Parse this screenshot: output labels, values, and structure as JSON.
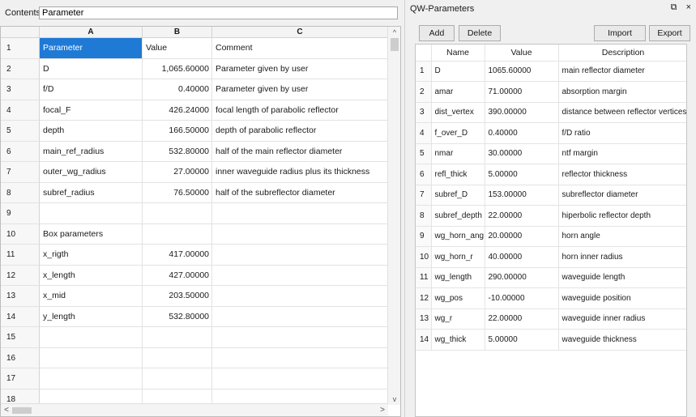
{
  "sheet": {
    "contents_label": "Contents",
    "contents_value": "Parameter",
    "columns": [
      "A",
      "B",
      "C"
    ],
    "rows": [
      {
        "n": "1",
        "a": "Parameter",
        "b": "Value",
        "c": "Comment",
        "selected_a": true
      },
      {
        "n": "2",
        "a": "D",
        "b": "1,065.60000",
        "c": "Parameter given by user"
      },
      {
        "n": "3",
        "a": "f/D",
        "b": "0.40000",
        "c": "Parameter given by user"
      },
      {
        "n": "4",
        "a": "focal_F",
        "b": "426.24000",
        "c": "focal length of parabolic reflector"
      },
      {
        "n": "5",
        "a": "depth",
        "b": "166.50000",
        "c": "depth of parabolic reflector"
      },
      {
        "n": "6",
        "a": "main_ref_radius",
        "b": "532.80000",
        "c": "half of the main reflector diameter"
      },
      {
        "n": "7",
        "a": "outer_wg_radius",
        "b": "27.00000",
        "c": "inner waveguide radius plus its thickness"
      },
      {
        "n": "8",
        "a": "subref_radius",
        "b": "76.50000",
        "c": "half of the subreflector diameter"
      },
      {
        "n": "9",
        "a": "",
        "b": "",
        "c": ""
      },
      {
        "n": "10",
        "a": "Box parameters",
        "b": "",
        "c": ""
      },
      {
        "n": "11",
        "a": "x_rigth",
        "b": "417.00000",
        "c": ""
      },
      {
        "n": "12",
        "a": "x_length",
        "b": "427.00000",
        "c": ""
      },
      {
        "n": "13",
        "a": "x_mid",
        "b": "203.50000",
        "c": ""
      },
      {
        "n": "14",
        "a": "y_length",
        "b": "532.80000",
        "c": ""
      },
      {
        "n": "15",
        "a": "",
        "b": "",
        "c": ""
      },
      {
        "n": "16",
        "a": "",
        "b": "",
        "c": ""
      },
      {
        "n": "17",
        "a": "",
        "b": "",
        "c": ""
      },
      {
        "n": "18",
        "a": "",
        "b": "",
        "c": ""
      }
    ],
    "scroll_up": "^",
    "scroll_down": "v",
    "scroll_left": "<",
    "scroll_right": ">"
  },
  "panel": {
    "title": "QW-Parameters",
    "float_icon": "⧉",
    "close_icon": "×",
    "buttons": {
      "add": "Add",
      "delete": "Delete",
      "import": "Import",
      "export": "Export"
    },
    "headers": [
      "",
      "Name",
      "Value",
      "Description"
    ],
    "params": [
      {
        "i": "1",
        "name": "D",
        "value": "1065.60000",
        "desc": "main reflector diameter"
      },
      {
        "i": "2",
        "name": "amar",
        "value": "71.00000",
        "desc": "absorption margin"
      },
      {
        "i": "3",
        "name": "dist_vertex",
        "value": "390.00000",
        "desc": "distance between reflector vertices"
      },
      {
        "i": "4",
        "name": "f_over_D",
        "value": "0.40000",
        "desc": "f/D ratio"
      },
      {
        "i": "5",
        "name": "nmar",
        "value": "30.00000",
        "desc": "ntf margin"
      },
      {
        "i": "6",
        "name": "refl_thick",
        "value": "5.00000",
        "desc": "reflector thickness"
      },
      {
        "i": "7",
        "name": "subref_D",
        "value": "153.00000",
        "desc": "subreflector diameter"
      },
      {
        "i": "8",
        "name": "subref_depth",
        "value": "22.00000",
        "desc": "hiperbolic reflector depth"
      },
      {
        "i": "9",
        "name": "wg_horn_ang",
        "value": "20.00000",
        "desc": "horn angle"
      },
      {
        "i": "10",
        "name": "wg_horn_r",
        "value": "40.00000",
        "desc": "horn inner radius"
      },
      {
        "i": "11",
        "name": "wg_length",
        "value": "290.00000",
        "desc": "waveguide length"
      },
      {
        "i": "12",
        "name": "wg_pos",
        "value": "-10.00000",
        "desc": "waveguide position"
      },
      {
        "i": "13",
        "name": "wg_r",
        "value": "22.00000",
        "desc": "waveguide inner radius"
      },
      {
        "i": "14",
        "name": "wg_thick",
        "value": "5.00000",
        "desc": "waveguide thickness"
      }
    ]
  }
}
